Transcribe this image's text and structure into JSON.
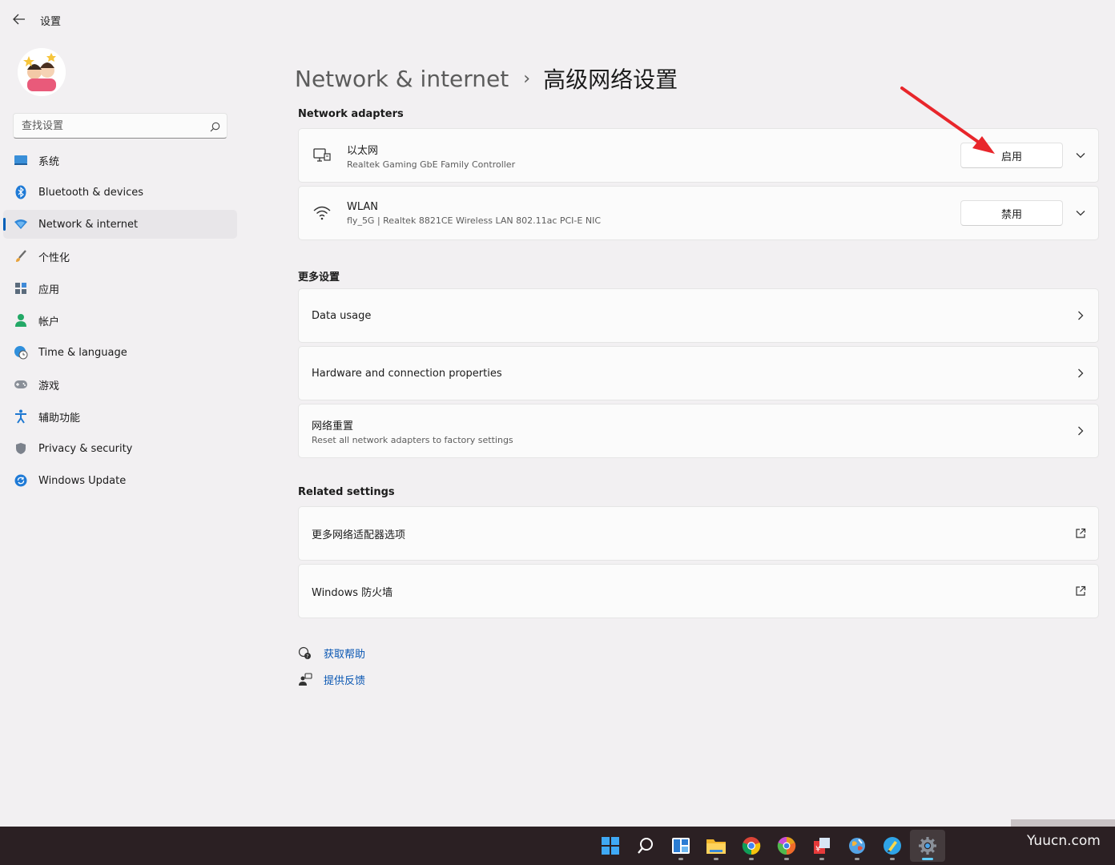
{
  "app": {
    "title": "设置"
  },
  "search": {
    "placeholder": "查找设置"
  },
  "sidebar": {
    "items": [
      {
        "label": "系统",
        "icon": "monitor-icon"
      },
      {
        "label": "Bluetooth & devices",
        "icon": "bluetooth-icon"
      },
      {
        "label": "Network & internet",
        "icon": "wifi-diamond-icon",
        "active": true
      },
      {
        "label": "个性化",
        "icon": "brush-icon"
      },
      {
        "label": "应用",
        "icon": "apps-icon"
      },
      {
        "label": "帐户",
        "icon": "person-icon"
      },
      {
        "label": "Time & language",
        "icon": "globe-clock-icon"
      },
      {
        "label": "游戏",
        "icon": "gamepad-icon"
      },
      {
        "label": "辅助功能",
        "icon": "accessibility-icon"
      },
      {
        "label": "Privacy & security",
        "icon": "shield-icon"
      },
      {
        "label": "Windows Update",
        "icon": "update-icon"
      }
    ]
  },
  "header": {
    "parent": "Network & internet",
    "separator": "›",
    "current": "高级网络设置"
  },
  "adapters": {
    "title": "Network adapters",
    "items": [
      {
        "name": "以太网",
        "desc": "Realtek Gaming GbE Family Controller",
        "button": "启用",
        "icon": "ethernet-icon"
      },
      {
        "name": "WLAN",
        "desc": "fly_5G | Realtek 8821CE Wireless LAN 802.11ac PCI-E NIC",
        "button": "禁用",
        "icon": "wifi-icon"
      }
    ]
  },
  "more": {
    "title": "更多设置",
    "items": [
      {
        "name": "Data usage",
        "desc": ""
      },
      {
        "name": "Hardware and connection properties",
        "desc": ""
      },
      {
        "name": "网络重置",
        "desc": "Reset all network adapters to factory settings"
      }
    ]
  },
  "related": {
    "title": "Related settings",
    "items": [
      {
        "name": "更多网络适配器选项"
      },
      {
        "name": "Windows 防火墙"
      }
    ]
  },
  "help": {
    "get_help": "获取帮助",
    "feedback": "提供反馈"
  },
  "taskbar": {
    "icons": [
      "start-icon",
      "search-icon",
      "widgets-icon",
      "file-explorer-icon",
      "chrome-icon",
      "chrome-canary-icon",
      "finance-app-icon",
      "map-app-icon",
      "notes-app-icon",
      "settings-icon"
    ],
    "active": "settings-icon"
  },
  "watermark": "Yuucn.com",
  "colors": {
    "accent": "#005fb8",
    "link": "#0a57b3",
    "annotation_arrow": "#e8262b",
    "taskbar": "#2b2023"
  }
}
